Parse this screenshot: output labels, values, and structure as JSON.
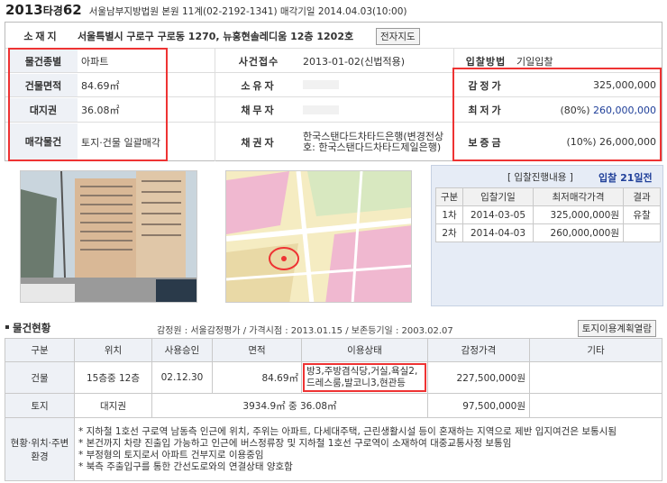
{
  "header": {
    "case_year": "2013",
    "case_type": "타경",
    "case_num": "62",
    "court_info": "서울남부지방법원 본원 11계(02-2192-1341) 매각기일 2014.04.03(10:00)"
  },
  "info": {
    "address_label": "소재지",
    "address": "서울특별시 구로구 구로동 1270, 뉴홍현솔레디움 12층 1202호",
    "map_btn": "전자지도",
    "type_label": "물건종별",
    "type_value": "아파트",
    "area_label": "건물면적",
    "area_value": "84.69㎡",
    "land_label": "대지권",
    "land_value": "36.08㎡",
    "sale_label": "매각물건",
    "sale_value": "토지·건물 일괄매각",
    "receipt_label": "사건접수",
    "receipt_value": "2013-01-02(신법적용)",
    "owner_label": "소유자",
    "debtor_label": "채무자",
    "creditor_label": "채권자",
    "creditor_value": "한국스탠다드차타드은행(변경전상호: 한국스탠다드차타드제일은행)",
    "bid_method_label": "입찰방법",
    "bid_method_value": "기일입찰",
    "appraisal_label": "감정가",
    "appraisal_value": "325,000,000",
    "min_label": "최저가",
    "min_pct": "(80%)",
    "min_value": "260,000,000",
    "deposit_label": "보증금",
    "deposit_value": "(10%) 26,000,000"
  },
  "bid": {
    "title": "[ 입찰진행내용 ]",
    "days": "입찰 21일전",
    "headers": [
      "구분",
      "입찰기일",
      "최저매각가격",
      "결과"
    ],
    "rows": [
      [
        "1차",
        "2014-03-05",
        "325,000,000원",
        "유찰"
      ],
      [
        "2차",
        "2014-04-03",
        "260,000,000원",
        ""
      ]
    ]
  },
  "status": {
    "title": "물건현황",
    "meta": "감정원 : 서울감정평가 / 가격시점 : 2013.01.15 / 보존등기일 : 2003.02.07",
    "land_plan_btn": "토지이용계획열람",
    "headers": [
      "구분",
      "위치",
      "사용승인",
      "면적",
      "이용상태",
      "감정가격",
      "기타"
    ],
    "building": {
      "kind": "건물",
      "location": "15층중 12층",
      "approval": "02.12.30",
      "area": "84.69㎡",
      "usage": "방3,주방겸식당,거실,욕실2,드레스룸,발코니3,현관등",
      "price": "227,500,000원"
    },
    "land": {
      "kind": "토지",
      "location": "대지권",
      "area": "3934.9㎡ 중 36.08㎡",
      "price": "97,500,000원"
    },
    "env_label": "현황·위치·주변환경",
    "notes": [
      "* 지하철 1호선 구로역 남동측 인근에 위치, 주위는 아파트, 다세대주택, 근린생활시설 등이 혼재하는 지역으로 제반 입지여건은 보통시됨",
      "* 본건까지 차량 진출입 가능하고 인근에 버스정류장 및 지하철 1호선 구로역이 소재하여 대중교통사정 보통임",
      "* 부정형의 토지로서 아파트 건부지로 이용중임",
      "* 북측 주출입구를 통한 간선도로와의 연결상태 양호함"
    ]
  },
  "colors": {
    "accent_red": "#e33333",
    "link_blue": "#1f3f99",
    "label_bg": "#eef1f6",
    "panel_bg": "#e6ecf6"
  }
}
